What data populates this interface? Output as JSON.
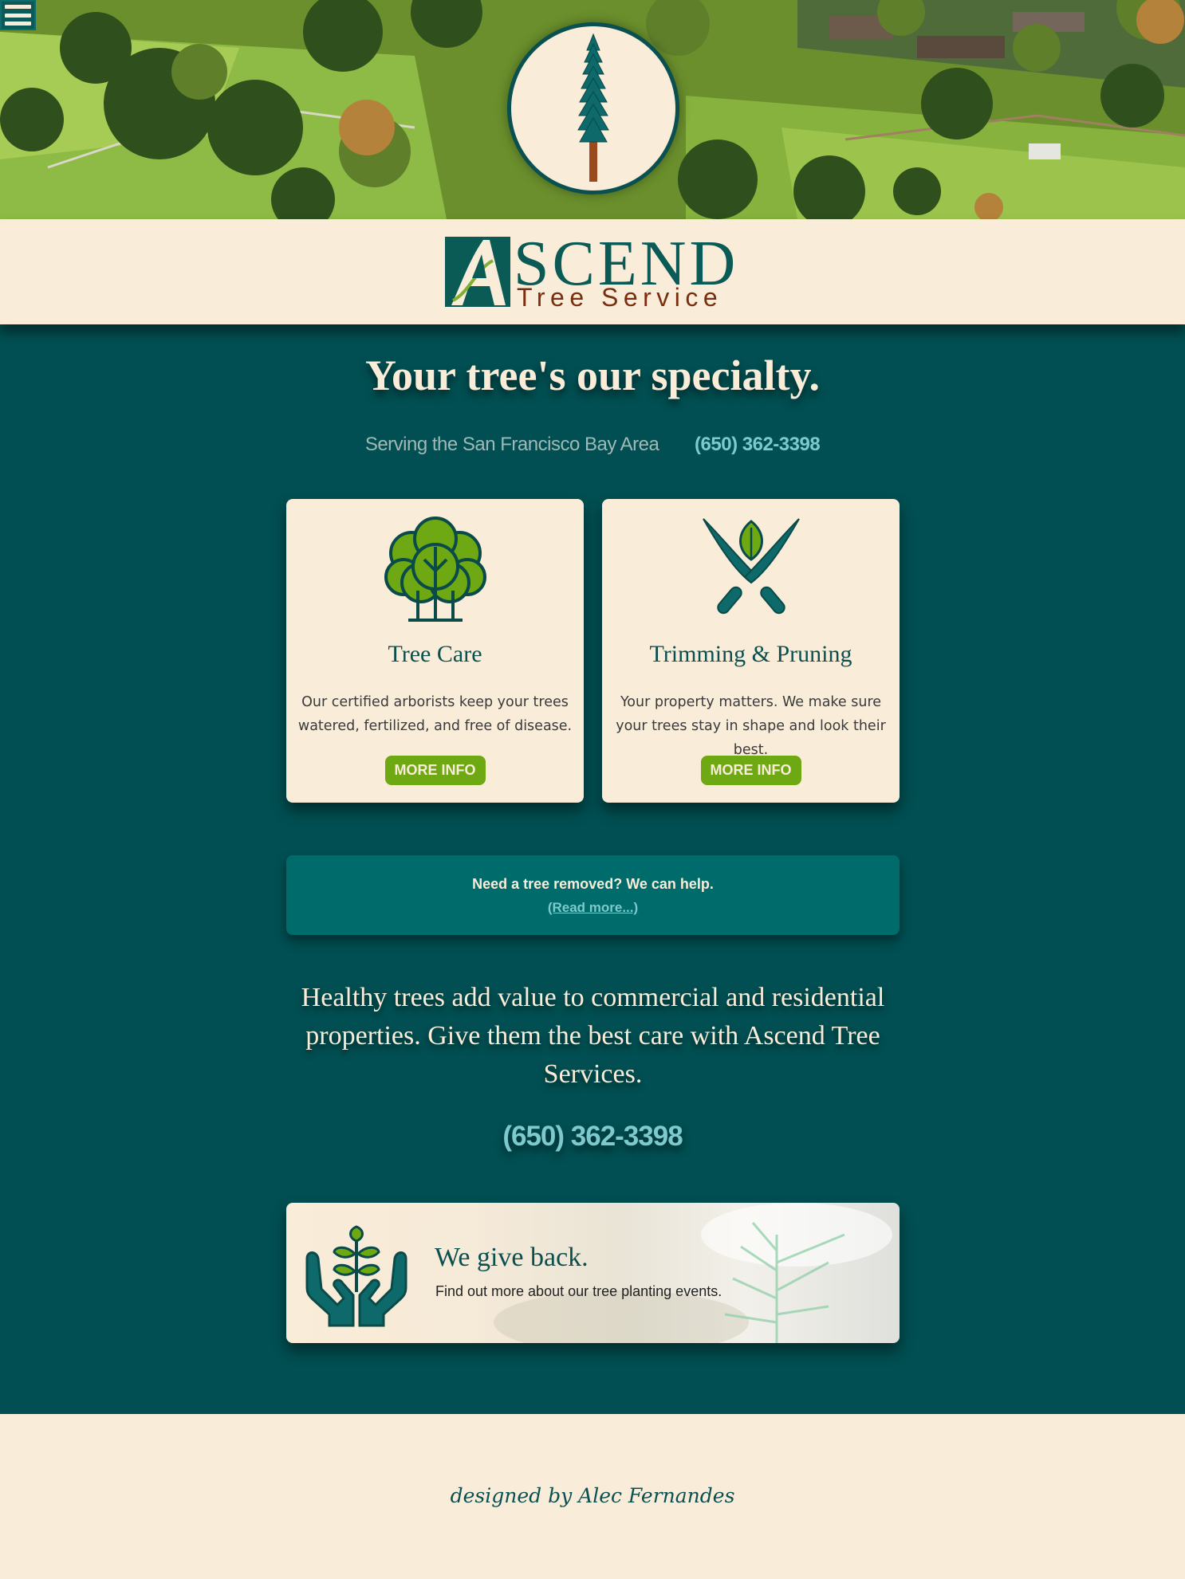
{
  "hero": {
    "menu_icon": "hamburger-menu-icon",
    "medallion_icon": "redwood-tree-icon"
  },
  "logo": {
    "mark_letter": "A",
    "name": "SCEND",
    "tagline": "Tree Service"
  },
  "main": {
    "headline": "Your tree's our specialty.",
    "service_area": "Serving the San Francisco Bay Area",
    "phone": "(650) 362-3398"
  },
  "cards": [
    {
      "title": "Tree Care",
      "icon": "tree-icon",
      "description": "Our certified arborists keep your trees watered, fertilized, and free of disease.",
      "button": "MORE INFO"
    },
    {
      "title": "Trimming & Pruning",
      "icon": "shears-leaf-icon",
      "description": "Your property matters. We make sure your trees stay in shape and look their best.",
      "button": "MORE INFO"
    }
  ],
  "removal": {
    "question": "Need a tree removed? We can help.",
    "link": "(Read more...)"
  },
  "value_text": "Healthy trees add value to commercial and residential properties. Give them the best care with Ascend Tree Services.",
  "cta_phone": "(650) 362-3398",
  "giveback": {
    "icon": "hands-sprout-icon",
    "title": "We give back.",
    "text": "Find out more about our tree planting events."
  },
  "footer": {
    "credit": "designed by Alec Fernandes"
  },
  "colors": {
    "teal_dark": "#014f52",
    "teal": "#006b6b",
    "cream": "#f9ecd9",
    "accent_green": "#6ea812",
    "link_cyan": "#7cc9ce",
    "brown": "#7a2e10"
  }
}
